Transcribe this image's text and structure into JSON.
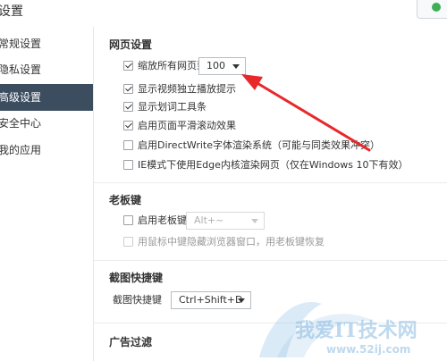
{
  "window": {
    "title": "设置"
  },
  "header": {
    "confirm_icon": "check-circle-icon",
    "confirm_color": "#3fae57"
  },
  "sidebar": {
    "items": [
      {
        "label": "常规设置",
        "active": false
      },
      {
        "label": "隐私设置",
        "active": false
      },
      {
        "label": "高级设置",
        "active": true
      },
      {
        "label": "安全中心",
        "active": false
      },
      {
        "label": "我的应用",
        "active": false
      }
    ],
    "active_bg": "#3c4d60"
  },
  "webpage": {
    "title": "网页设置",
    "zoom": {
      "label": "缩放所有网页到",
      "checked": true,
      "value": "100"
    },
    "options": [
      {
        "label": "显示视频独立播放提示",
        "checked": true
      },
      {
        "label": "显示划词工具条",
        "checked": true
      },
      {
        "label": "启用页面平滑滚动效果",
        "checked": true
      },
      {
        "label": "启用DirectWrite字体渲染系统（可能与同类效果冲突）",
        "checked": false
      },
      {
        "label": "IE模式下使用Edge内核渲染网页（仅在Windows 10下有效）",
        "checked": false
      }
    ]
  },
  "bosskey": {
    "title": "老板键",
    "enable_label": "启用老板键",
    "enable_checked": false,
    "key_value": "Alt+~",
    "middle_click_label": "用鼠标中键隐藏浏览器窗口，用老板键恢复",
    "middle_click_checked": false
  },
  "screenshot": {
    "title": "截图快捷键",
    "label": "截图快捷键",
    "value": "Ctrl+Shift+D"
  },
  "adblock": {
    "title": "广告过滤"
  },
  "annotation": {
    "arrow_color": "#e8282b"
  },
  "watermark": {
    "text": "我爱IT技术网",
    "url": "www.52ij.com"
  }
}
